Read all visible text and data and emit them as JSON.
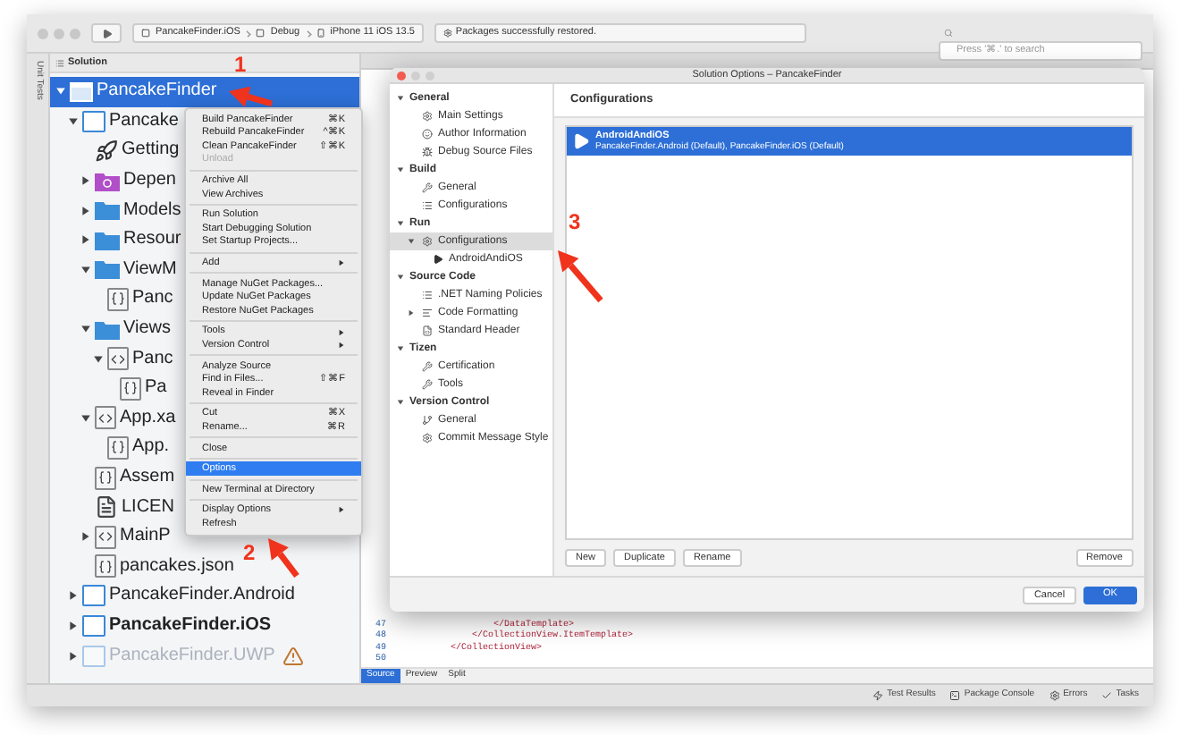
{
  "toolbar": {
    "run_target": [
      "PancakeFinder.iOS",
      "Debug",
      "iPhone 11 iOS 13.5"
    ],
    "status": "Packages successfully restored.",
    "search": {
      "placeholder": "Press '⌘.' to search"
    }
  },
  "left_strip": {
    "label": "Unit Tests"
  },
  "solution_pad": {
    "title": "Solution",
    "tree": [
      {
        "label": "PancakeFinder",
        "kind": "solution",
        "selected": true,
        "expanded": true,
        "children": [
          {
            "label": "Pancake",
            "kind": "project",
            "selected": false,
            "expanded": true,
            "children": [
              {
                "label": "Getting",
                "kind": "rocket",
                "selected": false
              },
              {
                "label": "Depen",
                "kind": "dependencies",
                "selected": false,
                "expanded": false
              },
              {
                "label": "Models",
                "kind": "folder",
                "selected": false,
                "expanded": false
              },
              {
                "label": "Resour",
                "kind": "folder",
                "selected": false,
                "expanded": false
              },
              {
                "label": "ViewM",
                "kind": "folder",
                "selected": false,
                "expanded": true,
                "children": [
                  {
                    "label": "Panc",
                    "kind": "code",
                    "selected": false
                  }
                ]
              },
              {
                "label": "Views",
                "kind": "folder",
                "selected": false,
                "expanded": true,
                "children": [
                  {
                    "label": "Panc",
                    "kind": "xaml",
                    "selected": false,
                    "expanded": true,
                    "children": [
                      {
                        "label": "Pa",
                        "kind": "code",
                        "selected": false
                      }
                    ]
                  }
                ]
              },
              {
                "label": "App.xa",
                "kind": "xaml",
                "selected": false,
                "expanded": true,
                "children": [
                  {
                    "label": "App.",
                    "kind": "code",
                    "selected": false
                  }
                ]
              },
              {
                "label": "Assem",
                "kind": "code",
                "selected": false
              },
              {
                "label": "LICEN",
                "kind": "file",
                "selected": false
              },
              {
                "label": "MainP",
                "kind": "xaml",
                "selected": false,
                "expanded": false
              },
              {
                "label": "pancakes.json",
                "kind": "code",
                "selected": false
              }
            ]
          },
          {
            "label": "PancakeFinder.Android",
            "kind": "project",
            "selected": false,
            "expanded": false,
            "startup": false,
            "disabled": false
          },
          {
            "label": "PancakeFinder.iOS",
            "kind": "project",
            "selected": false,
            "expanded": false,
            "startup": true,
            "disabled": false
          },
          {
            "label": "PancakeFinder.UWP",
            "kind": "project",
            "selected": false,
            "expanded": false,
            "startup": false,
            "disabled": true
          }
        ]
      }
    ]
  },
  "context_menu": {
    "groups": [
      [
        {
          "label": "Build PancakeFinder",
          "shortcut": "⌘K",
          "selected": false,
          "disabled": false
        },
        {
          "label": "Rebuild PancakeFinder",
          "shortcut": "^⌘K",
          "selected": false,
          "disabled": false
        },
        {
          "label": "Clean PancakeFinder",
          "shortcut": "⇧⌘K",
          "selected": false,
          "disabled": false
        },
        {
          "label": "Unload",
          "selected": false,
          "disabled": true
        }
      ],
      [
        {
          "label": "Archive All",
          "selected": false,
          "disabled": false
        },
        {
          "label": "View Archives",
          "selected": false,
          "disabled": false
        }
      ],
      [
        {
          "label": "Run Solution",
          "selected": false,
          "disabled": false
        },
        {
          "label": "Start Debugging Solution",
          "selected": false,
          "disabled": false
        },
        {
          "label": "Set Startup Projects...",
          "selected": false,
          "disabled": false
        }
      ],
      [
        {
          "label": "Add",
          "submenu": true,
          "selected": false,
          "disabled": false
        }
      ],
      [
        {
          "label": "Manage NuGet Packages...",
          "selected": false,
          "disabled": false
        },
        {
          "label": "Update NuGet Packages",
          "selected": false,
          "disabled": false
        },
        {
          "label": "Restore NuGet Packages",
          "selected": false,
          "disabled": false
        }
      ],
      [
        {
          "label": "Tools",
          "submenu": true,
          "selected": false,
          "disabled": false
        },
        {
          "label": "Version Control",
          "submenu": true,
          "selected": false,
          "disabled": false
        }
      ],
      [
        {
          "label": "Analyze Source",
          "selected": false,
          "disabled": false
        },
        {
          "label": "Find in Files...",
          "shortcut": "⇧⌘F",
          "selected": false,
          "disabled": false
        },
        {
          "label": "Reveal in Finder",
          "selected": false,
          "disabled": false
        }
      ],
      [
        {
          "label": "Cut",
          "shortcut": "⌘X",
          "selected": false,
          "disabled": false
        },
        {
          "label": "Rename...",
          "shortcut": "⌘R",
          "selected": false,
          "disabled": false
        }
      ],
      [
        {
          "label": "Close",
          "selected": false,
          "disabled": false
        }
      ],
      [
        {
          "label": "Options",
          "selected": true,
          "disabled": false
        }
      ],
      [
        {
          "label": "New Terminal at Directory",
          "selected": false,
          "disabled": false
        }
      ],
      [
        {
          "label": "Display Options",
          "submenu": true,
          "selected": false,
          "disabled": false
        },
        {
          "label": "Refresh",
          "selected": false,
          "disabled": false
        }
      ]
    ]
  },
  "editor": {
    "code_lines": [
      {
        "number": "47",
        "text": "</DataTemplate>"
      },
      {
        "number": "48",
        "text": "</CollectionView.ItemTemplate>"
      },
      {
        "number": "49",
        "text": "</CollectionView>"
      },
      {
        "number": "50"
      }
    ],
    "view_tabs": [
      {
        "label": "Source",
        "selected": true
      },
      {
        "label": "Preview",
        "selected": false
      },
      {
        "label": "Split",
        "selected": false
      }
    ]
  },
  "dialog": {
    "title": "Solution Options – PancakeFinder",
    "sidebar": [
      {
        "label": "General",
        "expanded": true,
        "children": [
          {
            "label": "Main Settings",
            "kind": "gear",
            "selected": false
          },
          {
            "label": "Author Information",
            "kind": "face",
            "selected": false
          },
          {
            "label": "Debug Source Files",
            "kind": "bug",
            "selected": false
          }
        ]
      },
      {
        "label": "Build",
        "expanded": true,
        "children": [
          {
            "label": "General",
            "kind": "wrench",
            "selected": false
          },
          {
            "label": "Configurations",
            "kind": "list",
            "selected": false
          }
        ]
      },
      {
        "label": "Run",
        "expanded": true,
        "children": [
          {
            "label": "Configurations",
            "kind": "gear",
            "selected": true,
            "expanded": true,
            "children": [
              {
                "label": "AndroidAndiOS",
                "kind": "play",
                "selected": false
              }
            ]
          }
        ]
      },
      {
        "label": "Source Code",
        "expanded": true,
        "children": [
          {
            "label": ".NET Naming Policies",
            "kind": "list",
            "selected": false
          },
          {
            "label": "Code Formatting",
            "kind": "format",
            "selected": false,
            "expanded": false
          },
          {
            "label": "Standard Header",
            "kind": "document",
            "selected": false
          }
        ]
      },
      {
        "label": "Tizen",
        "expanded": true,
        "children": [
          {
            "label": "Certification",
            "kind": "wrench",
            "selected": false
          },
          {
            "label": "Tools",
            "kind": "wrench",
            "selected": false
          }
        ]
      },
      {
        "label": "Version Control",
        "expanded": true,
        "children": [
          {
            "label": "General",
            "kind": "branch",
            "selected": false
          },
          {
            "label": "Commit Message Style",
            "kind": "gear",
            "selected": false
          }
        ]
      }
    ],
    "heading": "Configurations",
    "configurations": [
      {
        "name": "AndroidAndiOS",
        "detail": "PancakeFinder.Android (Default), PancakeFinder.iOS (Default)",
        "selected": true
      }
    ],
    "list_buttons": [
      "New",
      "Duplicate",
      "Rename"
    ],
    "remove_button": "Remove",
    "cancel_button": "Cancel",
    "ok_button": "OK"
  },
  "status_bar": [
    {
      "label": "Test Results",
      "kind": "tests"
    },
    {
      "label": "Package Console",
      "kind": "console"
    },
    {
      "label": "Errors",
      "kind": "errors"
    },
    {
      "label": "Tasks",
      "kind": "tasks"
    }
  ],
  "annotations": [
    {
      "label": "1"
    },
    {
      "label": "2"
    },
    {
      "label": "3"
    }
  ]
}
